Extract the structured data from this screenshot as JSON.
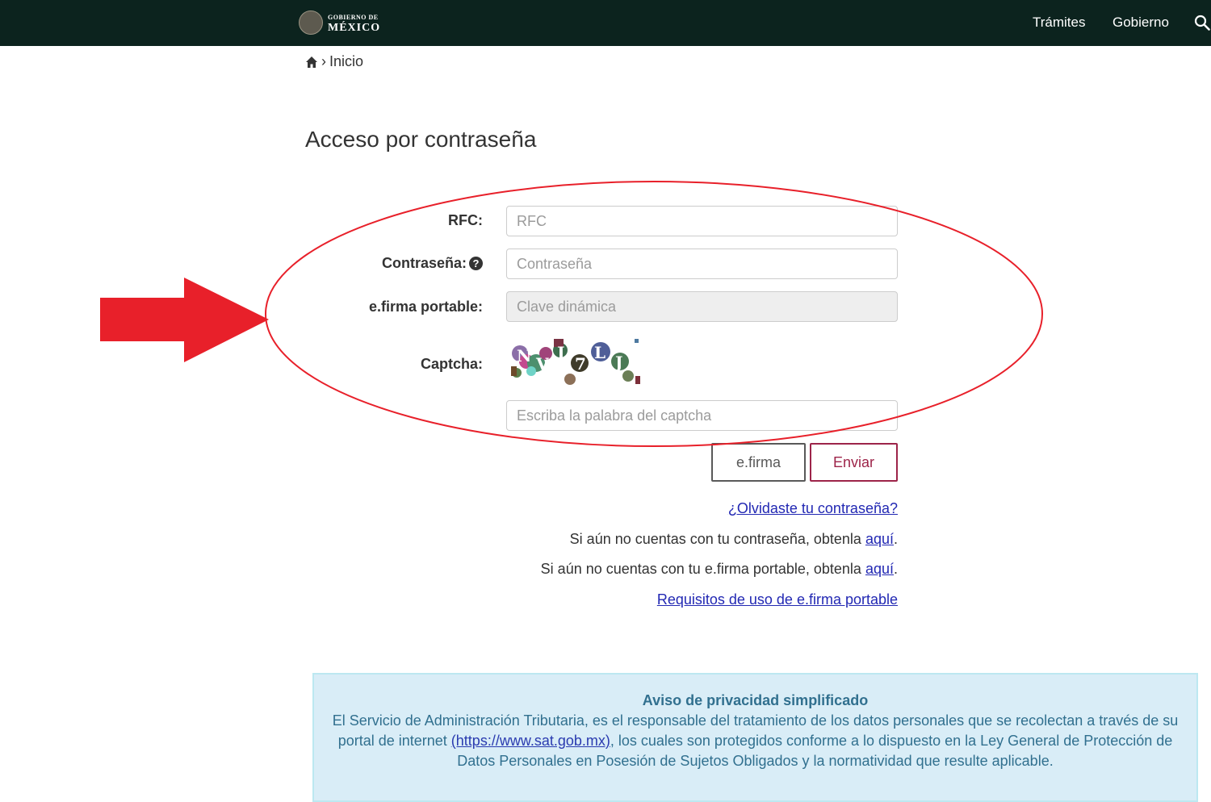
{
  "header": {
    "logo_small": "GOBIERNO DE",
    "logo_big": "MÉXICO",
    "nav": [
      "Trámites",
      "Gobierno"
    ],
    "search_icon": "search-icon",
    "bg_color": "#0c231e"
  },
  "breadcrumb": {
    "home_icon": "home-icon",
    "separator": "›",
    "current": "Inicio"
  },
  "page_title": "Acceso por contraseña",
  "form": {
    "rfc_label": "RFC:",
    "rfc_placeholder": "RFC",
    "password_label": "Contraseña:",
    "password_help_icon": "question-circle-icon",
    "password_placeholder": "Contraseña",
    "efirma_label": "e.firma portable:",
    "efirma_placeholder": "Clave dinámica",
    "captcha_label": "Captcha:",
    "captcha_text": "NVJ7LJ",
    "captcha_placeholder": "Escriba la palabra del captcha"
  },
  "buttons": {
    "efirma": "e.firma",
    "enviar": "Enviar",
    "enviar_color": "#9d2449"
  },
  "links": {
    "forgot": "¿Olvidaste tu contraseña?",
    "no_password_text": "Si aún no cuentas con tu contraseña, obtenla ",
    "no_password_link": "aquí",
    "no_efirma_text": "Si aún no cuentas con tu e.firma portable, obtenla ",
    "no_efirma_link": "aquí",
    "period": ".",
    "requisitos": "Requisitos de uso de e.firma portable"
  },
  "privacy": {
    "title": "Aviso de privacidad simplificado",
    "body_1": "El Servicio de Administración Tributaria, es el responsable del tratamiento de los datos personales que se recolectan a través de su portal de internet ",
    "url": "(https://www.sat.gob.mx)",
    "body_2": ", los cuales son protegidos conforme a lo dispuesto en la Ley General de Protección de Datos Personales en Posesión de Sujetos Obligados y la normatividad que resulte aplicable."
  },
  "annotation": {
    "color": "#e8202a",
    "arrow_icon": "red-arrow",
    "ellipse": "red-ellipse-highlight"
  }
}
